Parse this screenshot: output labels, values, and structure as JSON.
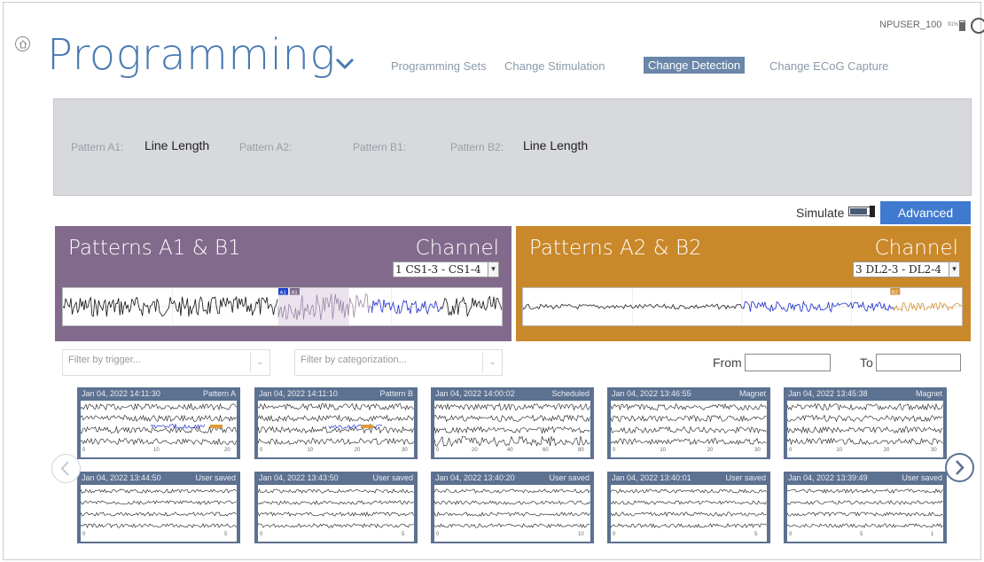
{
  "header": {
    "title": "Programming",
    "user": "NPUSER_100",
    "battery_pct": "91%"
  },
  "nav": {
    "tabs": [
      "Programming Sets",
      "Change Stimulation",
      "Change Detection",
      "Change ECoG Capture"
    ],
    "active": "Change Detection"
  },
  "patterns": [
    {
      "label": "Pattern A1:",
      "value": "Line Length"
    },
    {
      "label": "Pattern A2:",
      "value": ""
    },
    {
      "label": "Pattern B1:",
      "value": ""
    },
    {
      "label": "Pattern B2:",
      "value": "Line Length"
    }
  ],
  "simulate": {
    "label": "Simulate",
    "on": true
  },
  "advanced_label": "Advanced",
  "channels": {
    "left": {
      "title": "Patterns A1 & B1",
      "channel_label": "Channel",
      "selected": "1 CS1-3 - CS1-4",
      "markers": [
        "A1",
        "A1"
      ],
      "color": "#826a8c"
    },
    "right": {
      "title": "Patterns A2 & B2",
      "channel_label": "Channel",
      "selected": "3 DL2-3 - DL2-4",
      "markers": [
        "B2"
      ],
      "color": "#c9882a"
    }
  },
  "filters": {
    "trigger_placeholder": "Filter by trigger...",
    "categorization_placeholder": "Filter by categorization...",
    "from_label": "From",
    "to_label": "To"
  },
  "recordings": [
    {
      "date": "Jan 04, 2022 14:11:30",
      "trigger": "Pattern A",
      "ticks": [
        "0",
        "10",
        "20"
      ]
    },
    {
      "date": "Jan 04, 2022 14:11:10",
      "trigger": "Pattern B",
      "ticks": [
        "0",
        "10",
        "20",
        "30"
      ]
    },
    {
      "date": "Jan 04, 2022 14:00:02",
      "trigger": "Scheduled",
      "ticks": [
        "0",
        "20",
        "40",
        "60",
        "80"
      ]
    },
    {
      "date": "Jan 04, 2022 13:46:55",
      "trigger": "Magnet",
      "ticks": [
        "0",
        "10",
        "20",
        "30"
      ]
    },
    {
      "date": "Jan 04, 2022 13:45:38",
      "trigger": "Magnet",
      "ticks": [
        "0",
        "10",
        "20",
        "30"
      ]
    },
    {
      "date": "Jan 04, 2022 13:44:50",
      "trigger": "User saved",
      "ticks": [
        "0",
        "5"
      ]
    },
    {
      "date": "Jan 04, 2022 13:43:50",
      "trigger": "User saved",
      "ticks": [
        "0",
        "5"
      ]
    },
    {
      "date": "Jan 04, 2022 13:40:20",
      "trigger": "User saved",
      "ticks": [
        "0",
        "10"
      ]
    },
    {
      "date": "Jan 04, 2022 13:40:01",
      "trigger": "User saved",
      "ticks": [
        "0",
        "5"
      ]
    },
    {
      "date": "Jan 04, 2022 13:39:49",
      "trigger": "User saved",
      "ticks": [
        "0",
        "5",
        "1"
      ]
    }
  ]
}
